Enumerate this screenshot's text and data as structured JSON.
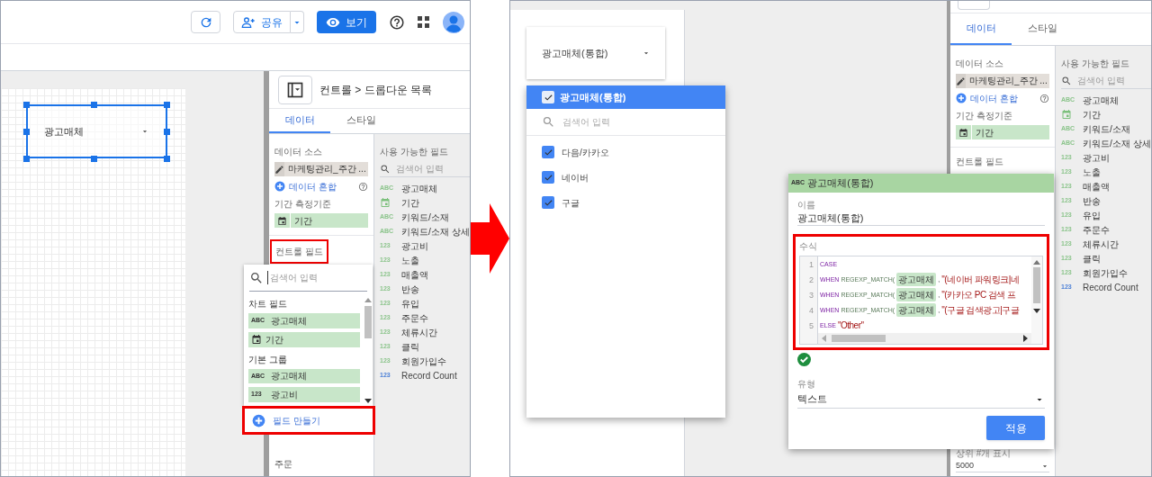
{
  "left_screen": {
    "toolbar": {
      "share_label": "공유",
      "view_label": "보기"
    },
    "canvas_control": {
      "label": "광고매체",
      "selected": true
    },
    "panel": {
      "title": "컨트롤 > 드롭다운 목록",
      "tabs": [
        {
          "label": "데이터",
          "selected": true
        },
        {
          "label": "스타일",
          "selected": false
        }
      ],
      "data_source_label": "데이터 소스",
      "data_source": "마케팅관리_주간 ...",
      "blend_label": "데이터 혼합",
      "date_dimension_label": "기간 측정기준",
      "date_dimension": "기간",
      "control_field_label": "컨트롤 필드",
      "control_field_highlighted": true,
      "available_fields_label": "사용 가능한 필드",
      "search_placeholder": "검색어 입력",
      "fields": [
        {
          "kind": "text",
          "type_label": "ABC",
          "name": "광고매체"
        },
        {
          "kind": "date",
          "name": "기간"
        },
        {
          "kind": "text",
          "type_label": "ABC",
          "name": "키워드/소재"
        },
        {
          "kind": "text",
          "type_label": "ABC",
          "name": "키워드/소재 상세"
        },
        {
          "kind": "number",
          "type_label": "123",
          "name": "광고비"
        },
        {
          "kind": "number",
          "type_label": "123",
          "name": "노출"
        },
        {
          "kind": "number",
          "type_label": "123",
          "name": "매출액"
        },
        {
          "kind": "number",
          "type_label": "123",
          "name": "반송"
        },
        {
          "kind": "number",
          "type_label": "123",
          "name": "유입"
        },
        {
          "kind": "number",
          "type_label": "123",
          "name": "주문수"
        },
        {
          "kind": "number",
          "type_label": "123",
          "name": "체류시간"
        },
        {
          "kind": "number",
          "type_label": "123",
          "name": "클릭"
        },
        {
          "kind": "number",
          "type_label": "123",
          "name": "회원가입수"
        },
        {
          "kind": "count",
          "type_label": "123",
          "name": "Record Count"
        }
      ],
      "sort_label": "주문"
    },
    "field_picker": {
      "search_placeholder": "검색어 입력",
      "groups": [
        {
          "title": "차트 필드",
          "items": [
            {
              "kind": "text",
              "type_label": "ABC",
              "name": "광고매체"
            },
            {
              "kind": "date",
              "name": "기간"
            }
          ]
        },
        {
          "title": "기본 그룹",
          "items": [
            {
              "kind": "text",
              "type_label": "ABC",
              "name": "광고매체"
            },
            {
              "kind": "number",
              "type_label": "123",
              "name": "광고비"
            }
          ]
        }
      ],
      "create_label": "필드 만들기",
      "create_highlighted": true
    }
  },
  "right_screen": {
    "canvas_control": {
      "label": "광고매체(통합)"
    },
    "dropdown_list": {
      "header": {
        "label": "광고매체(통합)",
        "checked": true
      },
      "search_placeholder": "검색어 입력",
      "options": [
        {
          "label": "다음/카카오",
          "checked": true
        },
        {
          "label": "네이버",
          "checked": true
        },
        {
          "label": "구글",
          "checked": true
        }
      ]
    },
    "field_editor": {
      "type_label": "ABC",
      "title": "광고매체(통합)",
      "name_label": "이름",
      "name_value": "광고매체(통합)",
      "formula_label": "수식",
      "formula_highlighted": true,
      "code_lines": [
        {
          "number": "1",
          "tokens": [
            {
              "kind": "keyword",
              "text": "CASE"
            }
          ]
        },
        {
          "number": "2",
          "tokens": [
            {
              "kind": "keyword",
              "text": "WHEN"
            },
            {
              "kind": "function",
              "text": "REGEXP_MATCH("
            },
            {
              "kind": "field",
              "text": "광고매체"
            },
            {
              "kind": "plain",
              "text": ","
            },
            {
              "kind": "string",
              "text": "\"(네이버 파워링크|네"
            }
          ]
        },
        {
          "number": "3",
          "tokens": [
            {
              "kind": "keyword",
              "text": "WHEN"
            },
            {
              "kind": "function",
              "text": "REGEXP_MATCH("
            },
            {
              "kind": "field",
              "text": "광고매체"
            },
            {
              "kind": "plain",
              "text": ","
            },
            {
              "kind": "string",
              "text": "\"(카카오 PC 검색 프"
            }
          ]
        },
        {
          "number": "4",
          "tokens": [
            {
              "kind": "keyword",
              "text": "WHEN"
            },
            {
              "kind": "function",
              "text": "REGEXP_MATCH("
            },
            {
              "kind": "field",
              "text": "광고매체"
            },
            {
              "kind": "plain",
              "text": ","
            },
            {
              "kind": "string",
              "text": "\"(구글 검색광고|구글"
            }
          ]
        },
        {
          "number": "5",
          "tokens": [
            {
              "kind": "keyword",
              "text": "ELSE"
            },
            {
              "kind": "string",
              "text": "\"Other\""
            }
          ]
        }
      ],
      "valid": true,
      "type_field_label": "유형",
      "type_value": "텍스트",
      "apply_label": "적용"
    },
    "panel": {
      "tabs": [
        {
          "label": "데이터",
          "selected": true
        },
        {
          "label": "스타일",
          "selected": false
        }
      ],
      "data_source_label": "데이터 소스",
      "data_source": "마케팅관리_주간 ...",
      "blend_label": "데이터 혼합",
      "date_dimension_label": "기간 측정기준",
      "date_dimension": "기간",
      "control_field_label": "컨트롤 필드",
      "control_field_highlighted": false,
      "available_fields_label": "사용 가능한 필드",
      "search_placeholder": "검색어 입력",
      "fields": [
        {
          "kind": "text",
          "type_label": "ABC",
          "name": "광고매체"
        },
        {
          "kind": "date",
          "name": "기간"
        },
        {
          "kind": "text",
          "type_label": "ABC",
          "name": "키워드/소재"
        },
        {
          "kind": "text",
          "type_label": "ABC",
          "name": "키워드/소재 상세"
        },
        {
          "kind": "number",
          "type_label": "123",
          "name": "광고비"
        },
        {
          "kind": "number",
          "type_label": "123",
          "name": "노출"
        },
        {
          "kind": "number",
          "type_label": "123",
          "name": "매출액"
        },
        {
          "kind": "number",
          "type_label": "123",
          "name": "반송"
        },
        {
          "kind": "number",
          "type_label": "123",
          "name": "유입"
        },
        {
          "kind": "number",
          "type_label": "123",
          "name": "주문수"
        },
        {
          "kind": "number",
          "type_label": "123",
          "name": "체류시간"
        },
        {
          "kind": "number",
          "type_label": "123",
          "name": "클릭"
        },
        {
          "kind": "number",
          "type_label": "123",
          "name": "회원가입수"
        },
        {
          "kind": "count",
          "type_label": "123",
          "name": "Record Count"
        }
      ],
      "top_n_label": "상위 #개 표시",
      "top_n_value": "5000"
    }
  }
}
